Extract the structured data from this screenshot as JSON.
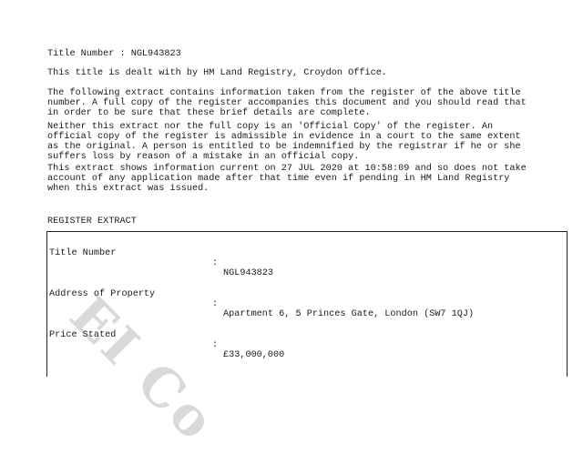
{
  "header": {
    "title_number_line": "Title Number : NGL943823",
    "office_line": "This title is dealt with by HM Land Registry, Croydon Office."
  },
  "paragraphs": [
    [
      "The following extract contains information taken from the register of the above title",
      "number. A full copy of the register accompanies this document and you should read that",
      "in order to be sure that these brief details are complete."
    ],
    [
      "Neither this extract nor the full copy is an 'Official Copy' of the register. An",
      "official copy of the register is admissible in evidence in a court to the same extent",
      "as the original. A person is entitled to be indemnified by the registrar if he or she",
      "suffers loss by reason of a mistake in an official copy."
    ],
    [
      "This extract shows information current on 27 JUL 2020 at 10:58:09 and so does not take",
      "account of any application made after that time even if pending in HM Land Registry",
      "when this extract was issued."
    ]
  ],
  "extract": {
    "heading": "REGISTER EXTRACT",
    "separator": ":",
    "rows": [
      {
        "label": "Title Number",
        "value": "NGL943823"
      },
      {
        "label": "Address of Property",
        "value": "Apartment 6, 5 Princes Gate, London (SW7 1QJ)"
      },
      {
        "label": "Price Stated",
        "value": "£33,000,000"
      }
    ]
  },
  "watermark": {
    "text": "EI Co"
  }
}
